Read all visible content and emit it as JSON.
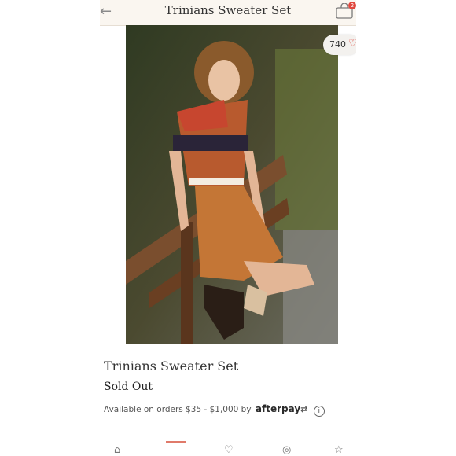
{
  "header": {
    "title": "Trinians Sweater Set",
    "cart_count": "2"
  },
  "likes": {
    "count": "740"
  },
  "product": {
    "title": "Trinians Sweater Set",
    "status": "Sold Out",
    "payment_text": "Available on orders $35 - $1,000 by",
    "afterpay_brand": "afterpay"
  },
  "icons": [
    "back-arrow-icon",
    "shopping-bag-icon",
    "heart-icon",
    "info-icon",
    "hanger-icon",
    "home-icon",
    "heart-nav-icon",
    "compass-icon",
    "star-icon"
  ]
}
